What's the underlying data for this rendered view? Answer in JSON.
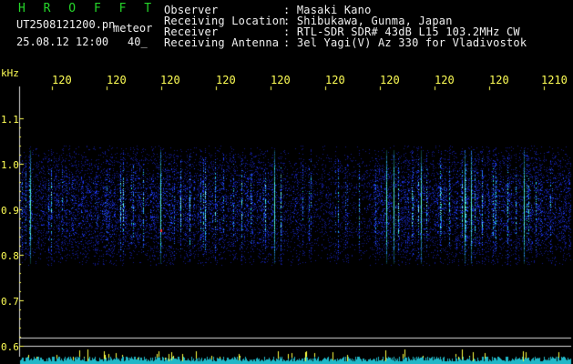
{
  "header": {
    "app_title": "H R O F F T",
    "filename": "UT2508121200.pn",
    "mode": "meteor",
    "datetime": "25.08.12 12:00",
    "count": "40_",
    "observer_label": "Observer",
    "observer_value": ": Masaki Kano",
    "location_label": "Receiving Location",
    "location_value": ": Shibukawa, Gunma, Japan",
    "receiver_label": "Receiver",
    "receiver_value": ": RTL-SDR SDR# 43dB L15 103.2MHz CW",
    "antenna_label": "Receiving Antenna",
    "antenna_value": ": 3el Yagi(V) Az 330 for Vladivostok"
  },
  "axis": {
    "unit": "kHz",
    "y_ticks": [
      "1.1",
      "1.0",
      "0.9",
      "0.8",
      "0.7",
      "0.6"
    ],
    "x_ticks": [
      "120",
      "120",
      "120",
      "120",
      "120",
      "120",
      "120",
      "120",
      "120",
      "1210"
    ]
  },
  "colors": {
    "background": "#000000",
    "title_green": "#25d62a",
    "label_yellow": "#ffff55",
    "signal_blue": "#1f3cff",
    "signal_cyan": "#28e4e4",
    "axis_white": "#f0f0f0"
  }
}
